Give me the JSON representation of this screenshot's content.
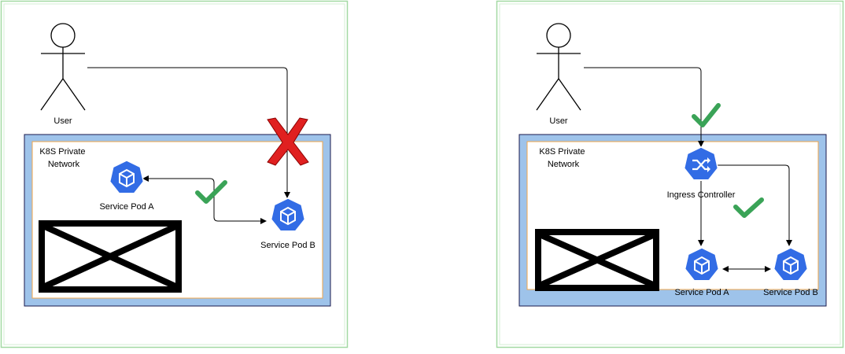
{
  "colors": {
    "frame_border": "#a3d9a3",
    "network_border": "#1a1a4d",
    "network_fill": "#9ec3ea",
    "network_inner_border": "#f0a54a",
    "pod_blue": "#326ce5",
    "check_green": "#3aa357",
    "cross_red": "#e02020",
    "line": "#000000"
  },
  "icons": {
    "user": "person-stick-figure-icon",
    "pod": "kubernetes-cube-icon",
    "ingress": "ingress-shuffle-icon",
    "check": "checkmark-icon",
    "cross": "red-x-icon",
    "placeholder": "image-placeholder-icon"
  },
  "left": {
    "user_label": "User",
    "network_label_line1": "K8S Private",
    "network_label_line2": "Network",
    "pod_a_label": "Service Pod A",
    "pod_b_label": "Service Pod B"
  },
  "right": {
    "user_label": "User",
    "network_label_line1": "K8S Private",
    "network_label_line2": "Network",
    "ingress_label": "Ingress Controller",
    "pod_a_label": "Service Pod A",
    "pod_b_label": "Service Pod B"
  }
}
